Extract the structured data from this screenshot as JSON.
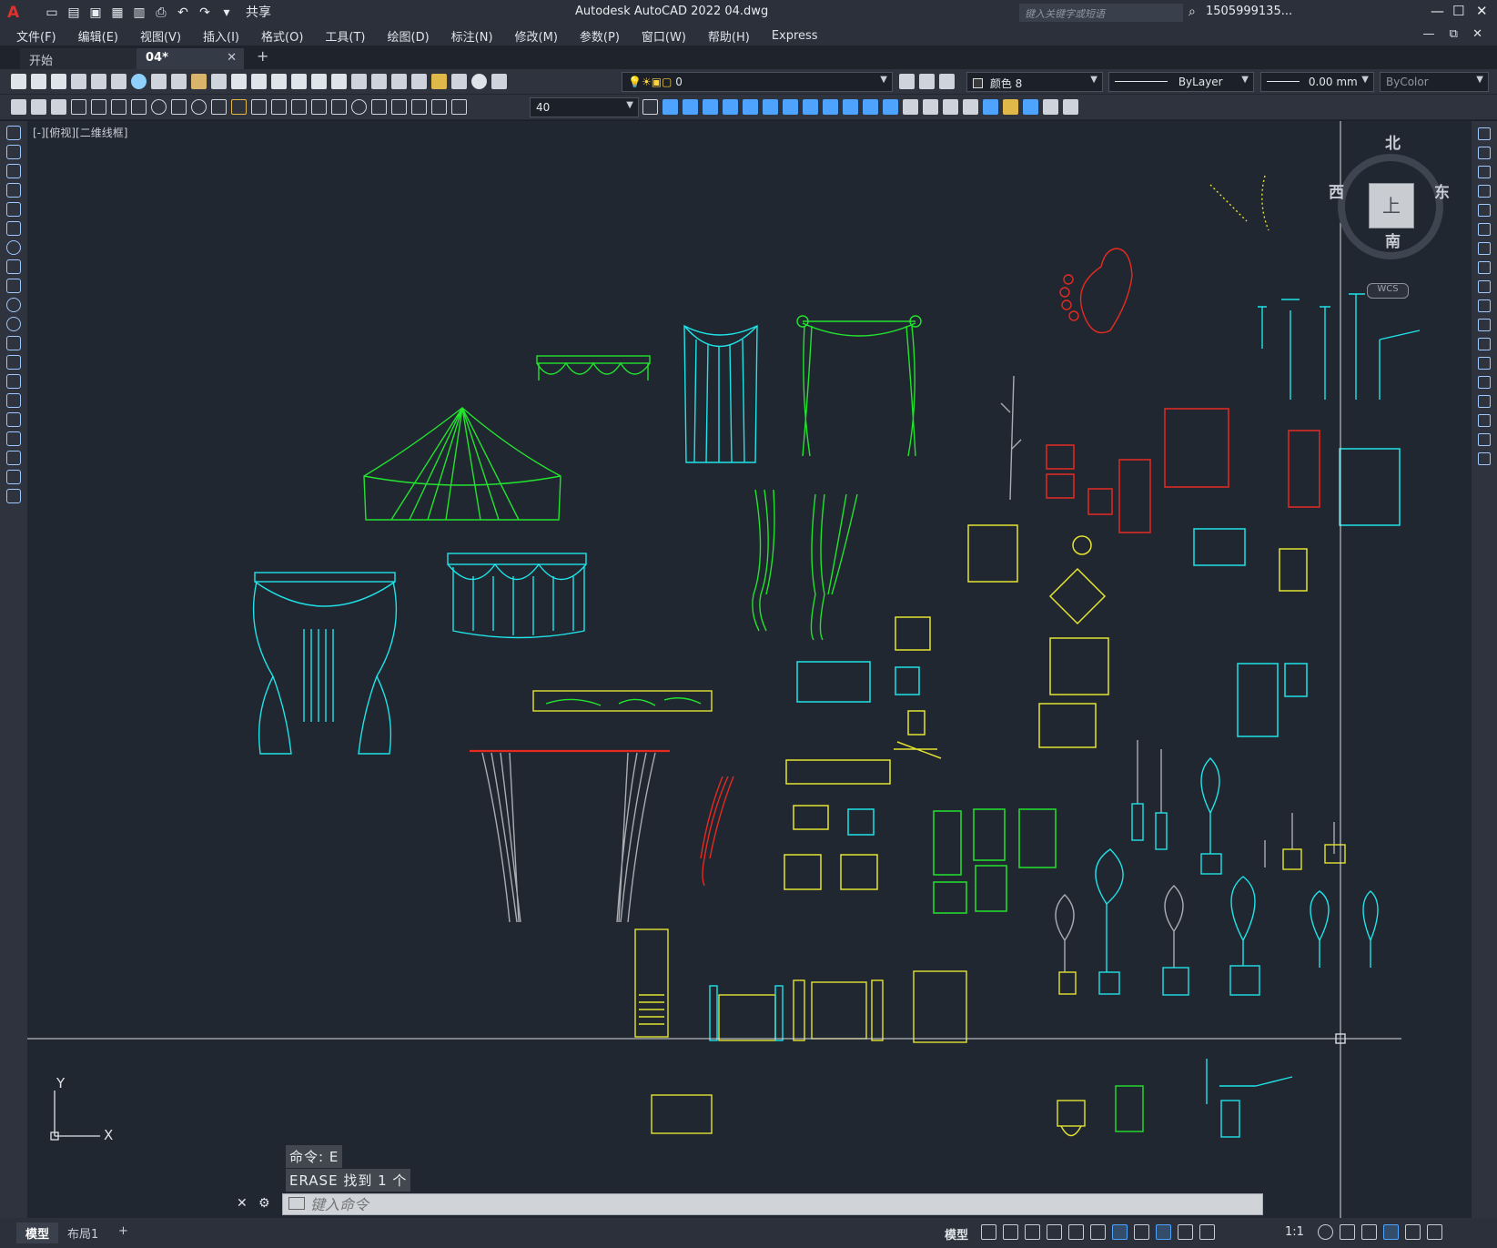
{
  "app": {
    "logo": "A",
    "title": "Autodesk AutoCAD 2022    04.dwg",
    "share_label": "共享",
    "search_placeholder": "键入关键字或短语",
    "user": "1505999135...",
    "window_controls": [
      "—",
      "☐",
      "✕"
    ]
  },
  "menu": {
    "items": [
      "文件(F)",
      "编辑(E)",
      "视图(V)",
      "插入(I)",
      "格式(O)",
      "工具(T)",
      "绘图(D)",
      "标注(N)",
      "修改(M)",
      "参数(P)",
      "窗口(W)",
      "帮助(H)",
      "Express"
    ],
    "mdi_controls": "— ⧉ ✕"
  },
  "tabs": {
    "start": "开始",
    "active": "04*",
    "close": "✕",
    "add": "+"
  },
  "toolbar": {
    "layer_value": "0",
    "color_value": "颜色 8",
    "linetype_value": "ByLayer",
    "lineweight_value": "0.00 mm",
    "plotstyle_value": "ByColor",
    "text_height_value": "40"
  },
  "viewport": {
    "label": "[-][俯视][二维线框]",
    "viewcube": {
      "north": "北",
      "south": "南",
      "east": "东",
      "west": "西",
      "face": "上",
      "wcs": "WCS"
    },
    "ucs": {
      "x": "X",
      "y": "Y"
    }
  },
  "command": {
    "history": [
      "命令: E",
      "ERASE 找到 1 个"
    ],
    "placeholder": "键入命令",
    "close_icon": "✕",
    "wrench_icon": "🔧"
  },
  "status": {
    "layout_tabs": [
      "模型",
      "布局1"
    ],
    "add_layout": "+",
    "model_label": "模型",
    "scale": "1:1"
  },
  "colors": {
    "accent": "#4ea3ff",
    "cyan": "#1ee3e8",
    "green": "#22e32e",
    "yellow": "#e4e331",
    "red": "#e52a22",
    "gray": "#a9acb2"
  }
}
